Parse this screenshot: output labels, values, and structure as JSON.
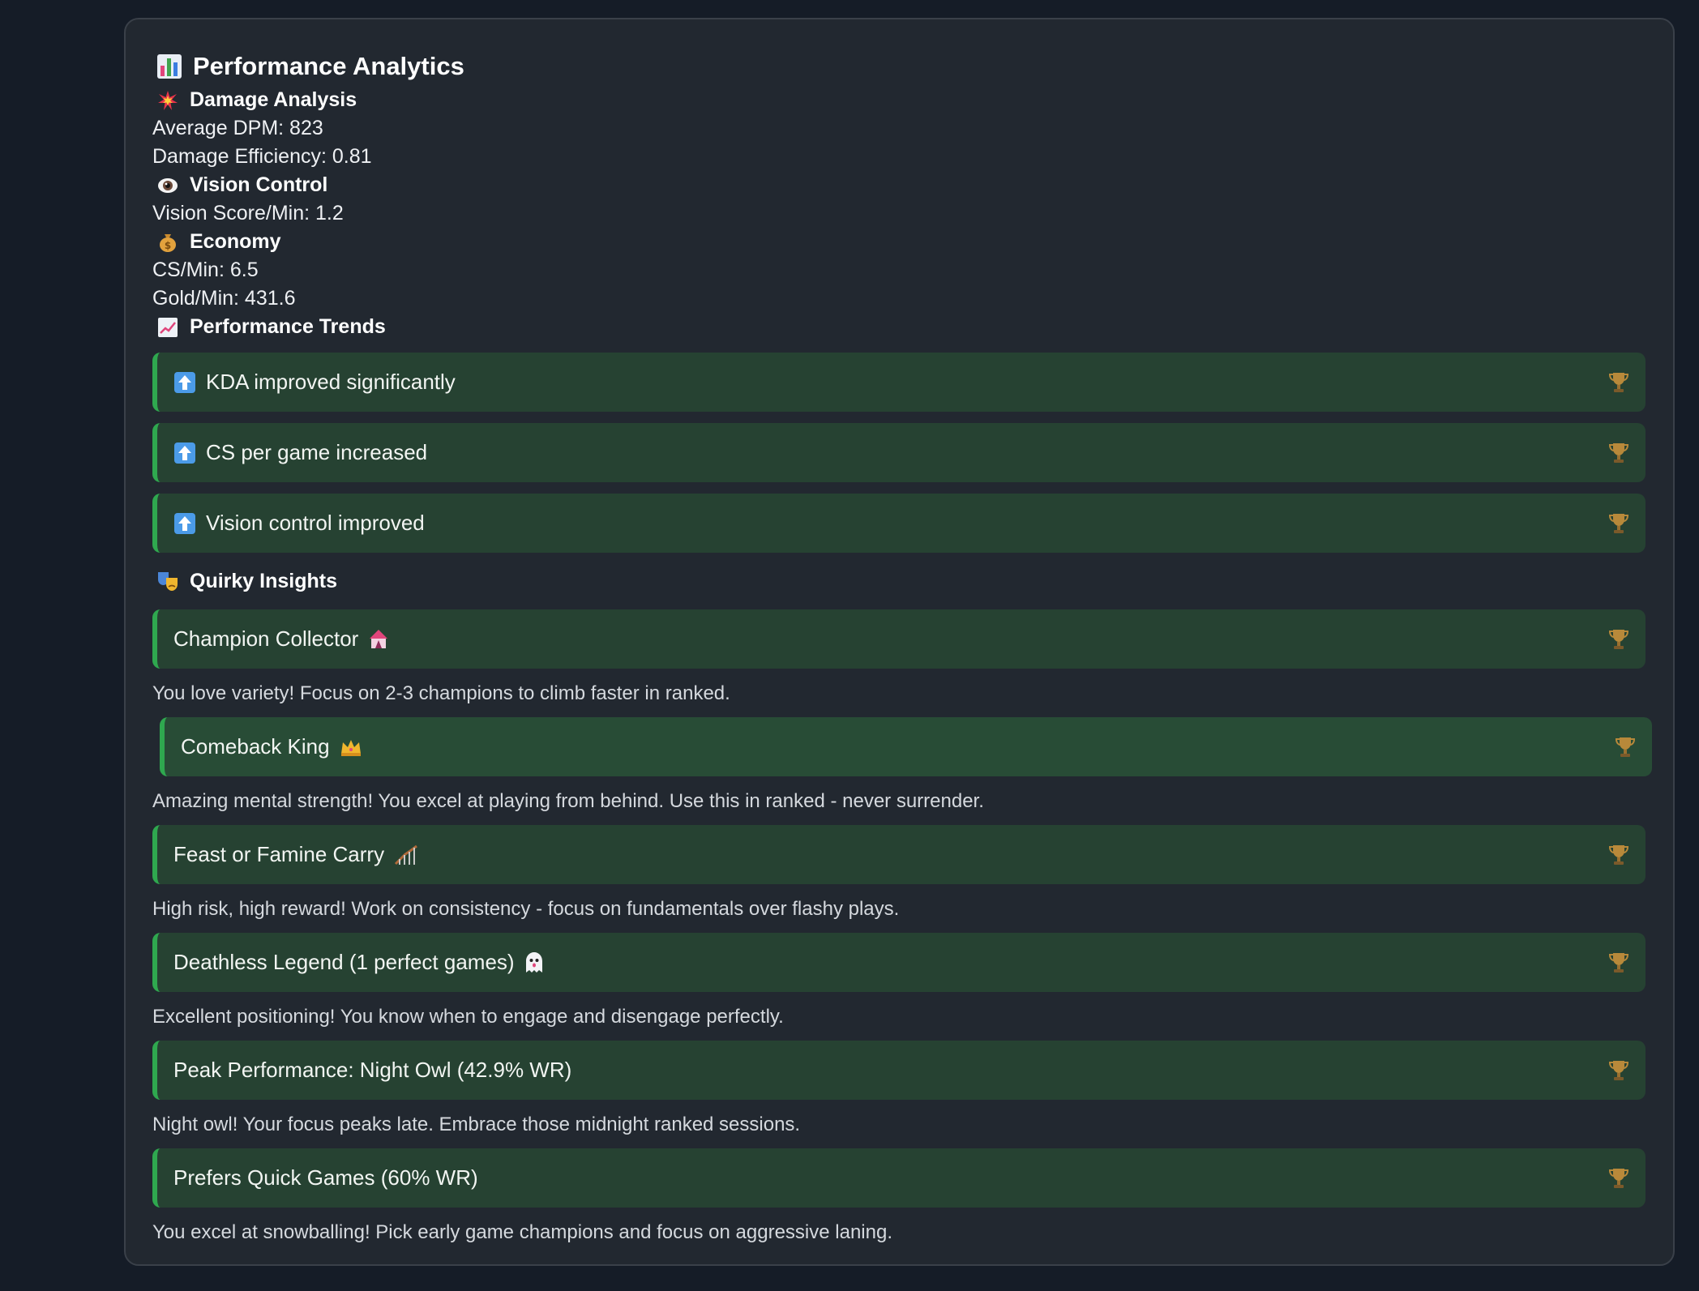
{
  "title": "Performance Analytics",
  "colors": {
    "background": "#151c27",
    "panel": "#222830",
    "card": "#264232",
    "card_accent": "#2fa84f"
  },
  "damage": {
    "heading": "Damage Analysis",
    "icon": "explosion-icon",
    "avg_dpm": "Average DPM: 823",
    "efficiency": "Damage Efficiency: 0.81"
  },
  "vision": {
    "heading": "Vision Control",
    "icon": "eye-icon",
    "score_per_min": "Vision Score/Min: 1.2"
  },
  "economy": {
    "heading": "Economy",
    "icon": "money-bag-icon",
    "cs_per_min": "CS/Min: 6.5",
    "gold_per_min": "Gold/Min: 431.6"
  },
  "trends": {
    "heading": "Performance Trends",
    "icon": "chart-increasing-icon",
    "items": [
      {
        "label": "KDA improved significantly",
        "icon": "up-arrow-icon"
      },
      {
        "label": "CS per game increased",
        "icon": "up-arrow-icon"
      },
      {
        "label": "Vision control improved",
        "icon": "up-arrow-icon"
      }
    ]
  },
  "insights": {
    "heading": "Quirky Insights",
    "icon": "theater-masks-icon",
    "items": [
      {
        "title": "Champion Collector",
        "emoji": "🎪",
        "description": "You love variety! Focus on 2-3 champions to climb faster in ranked."
      },
      {
        "title": "Comeback King",
        "emoji": "👑",
        "description": "Amazing mental strength! You excel at playing from behind. Use this in ranked - never surrender."
      },
      {
        "title": "Feast or Famine Carry",
        "emoji": "🎢",
        "description": "High risk, high reward! Work on consistency - focus on fundamentals over flashy plays."
      },
      {
        "title": "Deathless Legend (1 perfect games)",
        "emoji": "👻",
        "description": "Excellent positioning! You know when to engage and disengage perfectly."
      },
      {
        "title": "Peak Performance: Night Owl (42.9% WR)",
        "emoji": "",
        "description": "Night owl! Your focus peaks late. Embrace those midnight ranked sessions."
      },
      {
        "title": "Prefers Quick Games (60% WR)",
        "emoji": "",
        "description": "You excel at snowballing! Pick early game champions and focus on aggressive laning."
      }
    ]
  }
}
